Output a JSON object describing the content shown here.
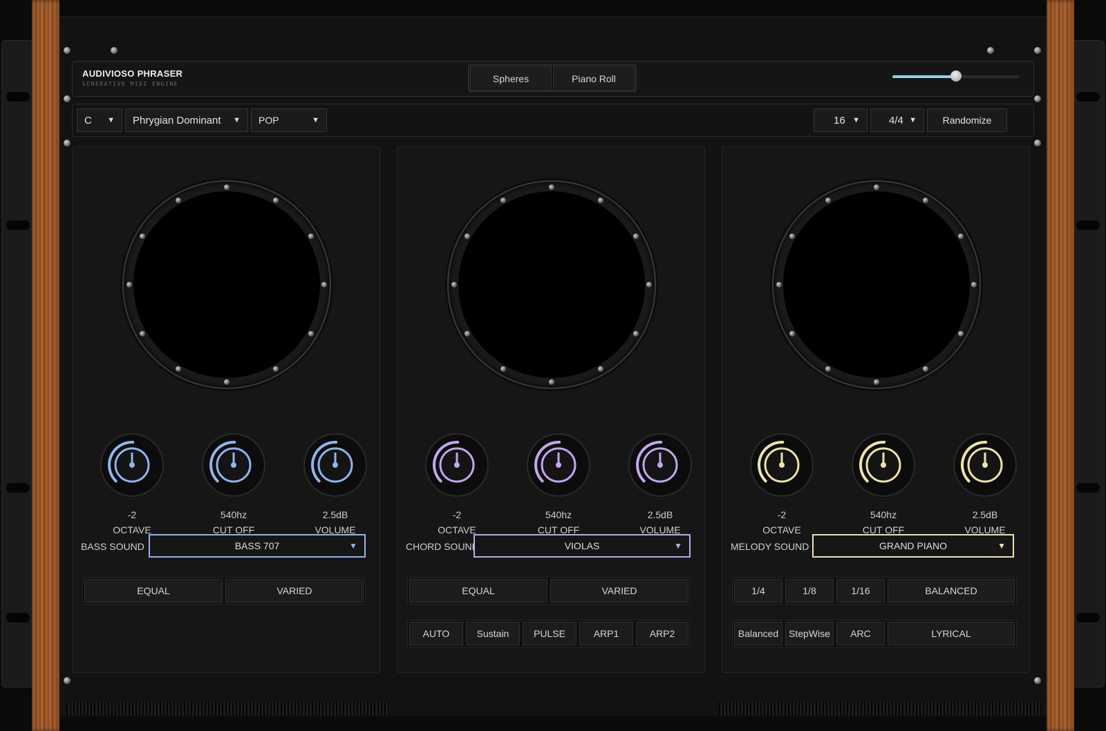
{
  "app": {
    "title": "AUDIVIOSO PHRASER",
    "subtitle": "GENERATIVE MIDI ENGINE"
  },
  "tabs": [
    {
      "label": "Spheres"
    },
    {
      "label": "Piano Roll"
    }
  ],
  "master_slider": {
    "value_fraction": 0.5
  },
  "toolbar": {
    "key": "C",
    "scale": "Phrygian Dominant",
    "genre": "POP",
    "steps": "16",
    "time_signature": "4/4",
    "randomize_label": "Randomize"
  },
  "panels": [
    {
      "accent": "#8fb4f0",
      "knobs": [
        {
          "value": "-2",
          "name": "OCTAVE"
        },
        {
          "value": "540hz",
          "name": "CUT OFF"
        },
        {
          "value": "2.5dB",
          "name": "VOLUME"
        }
      ],
      "sound_label": "BASS SOUND",
      "sound_value": "BASS 707",
      "row1": [
        "EQUAL",
        "VARIED"
      ]
    },
    {
      "accent": "#c3a6ee",
      "knobs": [
        {
          "value": "-2",
          "name": "OCTAVE"
        },
        {
          "value": "540hz",
          "name": "CUT OFF"
        },
        {
          "value": "2.5dB",
          "name": "VOLUME"
        }
      ],
      "sound_label": "CHORD SOUND",
      "sound_value": "VIOLAS",
      "row1": [
        "EQUAL",
        "VARIED"
      ],
      "row2": [
        "AUTO",
        "Sustain",
        "PULSE",
        "ARP1",
        "ARP2"
      ]
    },
    {
      "accent": "#efe3a8",
      "knobs": [
        {
          "value": "-2",
          "name": "OCTAVE"
        },
        {
          "value": "540hz",
          "name": "CUT OFF"
        },
        {
          "value": "2.5dB",
          "name": "VOLUME"
        }
      ],
      "sound_label": "MELODY SOUND",
      "sound_value": "GRAND PIANO",
      "row1": [
        "1/4",
        "1/8",
        "1/16",
        "BALANCED"
      ],
      "row2": [
        "Balanced",
        "StepWise",
        "ARC",
        "LYRICAL"
      ]
    }
  ],
  "icons": {
    "dropdown": "triangle-down-icon",
    "screw": "screw-icon"
  }
}
